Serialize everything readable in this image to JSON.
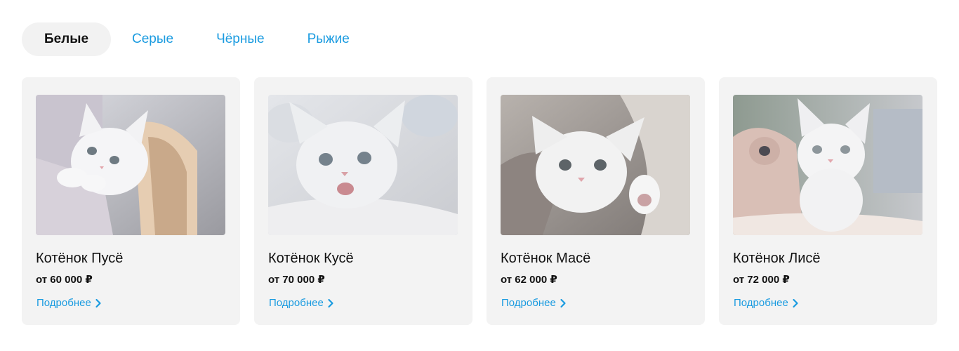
{
  "tabs": [
    {
      "label": "Белые",
      "active": true
    },
    {
      "label": "Серые",
      "active": false
    },
    {
      "label": "Чёрные",
      "active": false
    },
    {
      "label": "Рыжие",
      "active": false
    }
  ],
  "colors": {
    "accent": "#1a9be0",
    "card_bg": "#f3f3f3",
    "active_tab_bg": "#f2f2f2",
    "text": "#111111"
  },
  "cards": [
    {
      "title": "Котёнок Пусё",
      "price": "от 60 000 ₽",
      "link": "Подробнее",
      "link_icon": "chevron-right-icon"
    },
    {
      "title": "Котёнок Кусё",
      "price": "от 70 000 ₽",
      "link": "Подробнее",
      "link_icon": "chevron-right-icon"
    },
    {
      "title": "Котёнок Масё",
      "price": "от 62 000 ₽",
      "link": "Подробнее",
      "link_icon": "chevron-right-icon"
    },
    {
      "title": "Котёнок Лисё",
      "price": "от 72 000 ₽",
      "link": "Подробнее",
      "link_icon": "chevron-right-icon"
    }
  ]
}
